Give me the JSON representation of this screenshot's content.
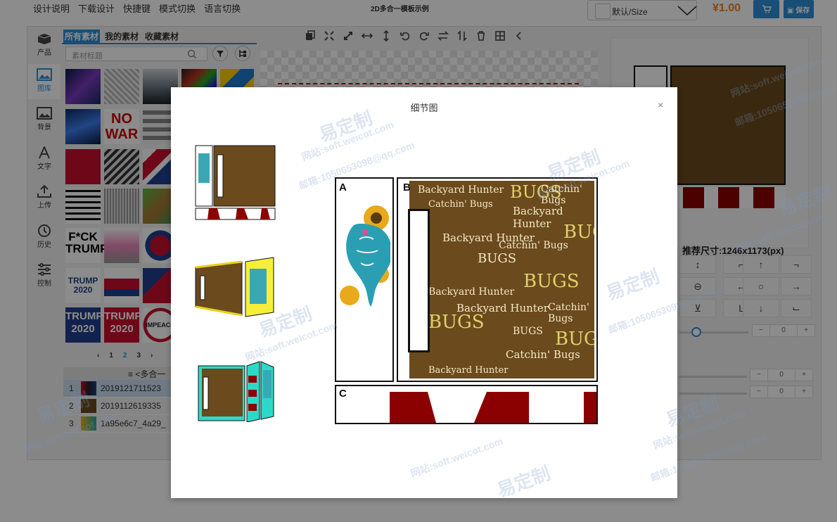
{
  "menu": [
    "设计说明",
    "下载设计",
    "快捷键",
    "模式切换",
    "语言切换"
  ],
  "doc_title": "2D多合一模板示例",
  "size_select": {
    "label": "默认/Size"
  },
  "price": "¥1.00",
  "save_label": "保存",
  "rail": [
    {
      "label": "产品",
      "icon": "box-icon"
    },
    {
      "label": "图库",
      "icon": "image-icon"
    },
    {
      "label": "背景",
      "icon": "background-icon"
    },
    {
      "label": "文字",
      "icon": "text-icon"
    },
    {
      "label": "上传",
      "icon": "upload-icon"
    },
    {
      "label": "历史",
      "icon": "history-icon"
    },
    {
      "label": "控制",
      "icon": "sliders-icon"
    }
  ],
  "tabs": [
    "所有素材",
    "我的素材",
    "收藏素材"
  ],
  "search": {
    "placeholder": "素材标题"
  },
  "pager": {
    "pages": [
      "1",
      "2",
      "3"
    ]
  },
  "layers": {
    "header": "<多合一",
    "rows": [
      {
        "index": "1",
        "name": "2019121711523"
      },
      {
        "index": "2",
        "name": "2019112619335"
      },
      {
        "index": "3",
        "name": "1a95e6c7_4a29_"
      }
    ]
  },
  "recommended_size": "推荐尺寸:1246x1173(px)",
  "steppers": [
    "0",
    "0",
    "0"
  ],
  "modal": {
    "title": "细节图",
    "close": "×",
    "part_labels": [
      "A",
      "B",
      "C"
    ]
  },
  "artwork_text": {
    "phrases": [
      "Backyard Hunter",
      "BUGS",
      "Catchin' Bugs",
      "Catchin'"
    ]
  },
  "thumb_texts": [
    "NO",
    "WAR",
    "F*CK",
    "TRUMP",
    "TRUMP",
    "2020",
    "TRUMP",
    "2020",
    "TRUMP",
    "2020",
    "IMPEACH"
  ],
  "watermark": {
    "brand": "易定制",
    "site": "网站:soft.weicot.com",
    "email": "邮箱:1050653098@qq.com"
  }
}
